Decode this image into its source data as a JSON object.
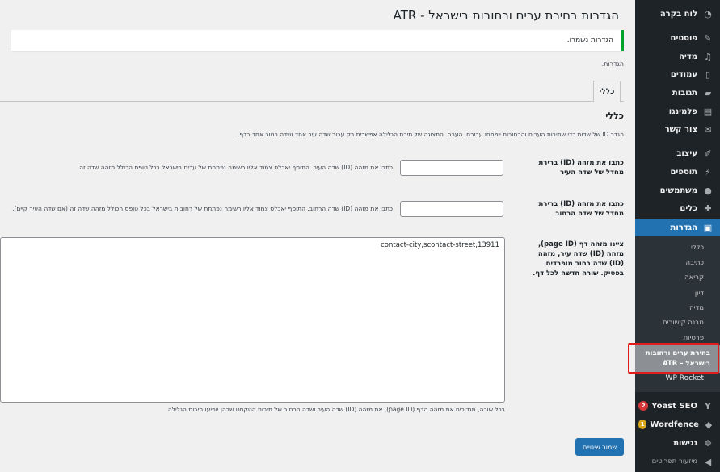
{
  "sidebar": {
    "items": [
      {
        "label": "לוח בקרה",
        "icon": "dashboard-icon"
      },
      {
        "label": "פוסטים",
        "icon": "pin-icon"
      },
      {
        "label": "מדיה",
        "icon": "media-icon"
      },
      {
        "label": "עמודים",
        "icon": "pages-icon"
      },
      {
        "label": "תגובות",
        "icon": "comments-icon"
      },
      {
        "label": "פלמינגו",
        "icon": "flamingo-icon"
      },
      {
        "label": "צור קשר",
        "icon": "mail-icon"
      },
      {
        "label": "עיצוב",
        "icon": "appearance-icon"
      },
      {
        "label": "תוספים",
        "icon": "plugins-icon"
      },
      {
        "label": "משתמשים",
        "icon": "users-icon"
      },
      {
        "label": "כלים",
        "icon": "tools-icon"
      },
      {
        "label": "הגדרות",
        "icon": "settings-icon"
      }
    ],
    "submenu": [
      "כללי",
      "כתיבה",
      "קריאה",
      "דיון",
      "מדיה",
      "מבנה קישורים",
      "פרטיות"
    ],
    "current_submenu": "בחירת ערים ורחובות בישראל – ATR",
    "wp_rocket": "WP Rocket",
    "yoast": {
      "label": "Yoast SEO",
      "badge": "2"
    },
    "wordfence": {
      "label": "Wordfence",
      "badge": "1"
    },
    "accessibility": "נגישות",
    "collapse": "מיזעור תפריטים"
  },
  "page": {
    "title": "הגדרות בחירת ערים ורחובות בישראל - ATR",
    "notice": "הגדרות נשמרו.",
    "subtitle": "הגדרות.",
    "tab_label": "כללי",
    "section_title": "כללי",
    "intro": "הגדר ID של שדות כדי שתיבות הערים והרחובות ייפתחו עבורם. הערה. התצוגה של תיבת הגלילה אפשרית רק עבור שדה עיר אחד ושדה רחוב אחד בדף.",
    "city_field": {
      "label": "כתבו את מזהה (ID) ברירת מחדל של שדה העיר",
      "value": "",
      "desc": "כתבו את מזהה (ID) שדה העיר. התוסף יאכלס צמוד אליו רשימה נפתחת של ערים בישראל בכל טופס הכולל מזהה שדה זה."
    },
    "street_field": {
      "label": "כתבו את מזהה (ID) ברירת מחדל של שדה הרחוב",
      "value": "",
      "desc": "כתבו את מזהה (ID) שדה הרחוב. התוסף יאכלס צמוד אליו רשימה נפתחת של רחובות בישראל בכל טופס הכולל מזהה שדה זה (אם שדה העיר קיים)."
    },
    "pages_field": {
      "label": "ציינו מזהה דף (page ID), מזהה (ID) שדה עיר, מזהה (ID) שדה רחוב מופרדים בפסיק. שורה חדשה לכל דף.",
      "value": "contact-city,scontact-street,13911",
      "desc": "בכל שורה, מגדירים את מזהה הדף (page ID), את מזהה (ID) שדה העיר ושדה הרחוב של תיבות הטקסט שבהן יופיעו תיבות הגלילה"
    },
    "save_label": "שמור שינויים"
  },
  "colors": {
    "accent": "#2271b1",
    "sidebar": "#1d2327",
    "notice_success": "#00a32a",
    "highlight": "#e11d1d"
  }
}
